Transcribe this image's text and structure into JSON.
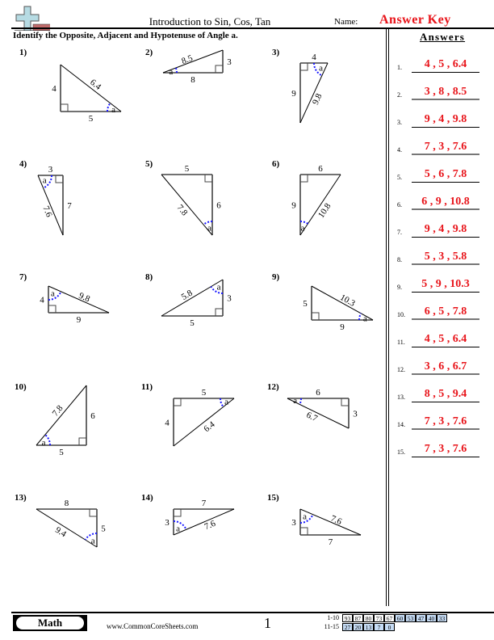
{
  "header": {
    "title": "Introduction to Sin, Cos, Tan",
    "name_label": "Name:",
    "name_value": "Answer Key",
    "instructions": "Identify the Opposite, Adjacent and Hypotenuse of Angle a.",
    "logo_icon": "plus-ruler-logo-icon"
  },
  "colors": {
    "answer_red": "#e8141a",
    "angle_arc_blue": "#1a1aff",
    "score_blue": "#c6dcf5",
    "logo_cross": "#b6dbe3",
    "logo_bar": "#c06a6a"
  },
  "angle_label": "a",
  "problems": [
    {
      "num": "1)",
      "sides": {
        "v": "4",
        "h": "5",
        "hyp": "6.4"
      }
    },
    {
      "num": "2)",
      "sides": {
        "v": "3",
        "h": "8",
        "hyp": "8.5"
      }
    },
    {
      "num": "3)",
      "sides": {
        "v": "9",
        "h": "4",
        "hyp": "9.8"
      }
    },
    {
      "num": "4)",
      "sides": {
        "v": "7",
        "h": "3",
        "hyp": "7.6"
      }
    },
    {
      "num": "5)",
      "sides": {
        "v": "6",
        "h": "5",
        "hyp": "7.8"
      }
    },
    {
      "num": "6)",
      "sides": {
        "v": "9",
        "h": "6",
        "hyp": "10.8"
      }
    },
    {
      "num": "7)",
      "sides": {
        "v": "4",
        "h": "9",
        "hyp": "9.8"
      }
    },
    {
      "num": "8)",
      "sides": {
        "v": "3",
        "h": "5",
        "hyp": "5.8"
      }
    },
    {
      "num": "9)",
      "sides": {
        "v": "5",
        "h": "9",
        "hyp": "10.3"
      }
    },
    {
      "num": "10)",
      "sides": {
        "v": "6",
        "h": "5",
        "hyp": "7.8"
      }
    },
    {
      "num": "11)",
      "sides": {
        "v": "4",
        "h": "5",
        "hyp": "6.4"
      }
    },
    {
      "num": "12)",
      "sides": {
        "v": "3",
        "h": "6",
        "hyp": "6.7"
      }
    },
    {
      "num": "13)",
      "sides": {
        "v": "5",
        "h": "8",
        "hyp": "9.4"
      }
    },
    {
      "num": "14)",
      "sides": {
        "v": "3",
        "h": "7",
        "hyp": "7.6"
      }
    },
    {
      "num": "15)",
      "sides": {
        "v": "3",
        "h": "7",
        "hyp": "7.6"
      }
    }
  ],
  "answers": {
    "heading": "Answers",
    "items": [
      {
        "num": "1.",
        "value": "4 , 5 , 6.4"
      },
      {
        "num": "2.",
        "value": "3 , 8 , 8.5"
      },
      {
        "num": "3.",
        "value": "9 , 4 , 9.8"
      },
      {
        "num": "4.",
        "value": "7 , 3 , 7.6"
      },
      {
        "num": "5.",
        "value": "5 , 6 , 7.8"
      },
      {
        "num": "6.",
        "value": "6 , 9 , 10.8"
      },
      {
        "num": "7.",
        "value": "9 , 4 , 9.8"
      },
      {
        "num": "8.",
        "value": "5 , 3 , 5.8"
      },
      {
        "num": "9.",
        "value": "5 , 9 , 10.3"
      },
      {
        "num": "10.",
        "value": "6 , 5 , 7.8"
      },
      {
        "num": "11.",
        "value": "4 , 5 , 6.4"
      },
      {
        "num": "12.",
        "value": "3 , 6 , 6.7"
      },
      {
        "num": "13.",
        "value": "8 , 5 , 9.4"
      },
      {
        "num": "14.",
        "value": "7 , 3 , 7.6"
      },
      {
        "num": "15.",
        "value": "7 , 3 , 7.6"
      }
    ]
  },
  "footer": {
    "badge": "Math",
    "site": "www.CommonCoreSheets.com",
    "page": "1",
    "score_rows": [
      {
        "label": "1-10",
        "cells": [
          "93",
          "87",
          "80",
          "73",
          "67",
          "60",
          "53",
          "47",
          "40",
          "33"
        ],
        "blue_from": 5
      },
      {
        "label": "11-15",
        "cells": [
          "27",
          "20",
          "13",
          "7",
          "0"
        ],
        "blue_from": 0
      }
    ]
  }
}
